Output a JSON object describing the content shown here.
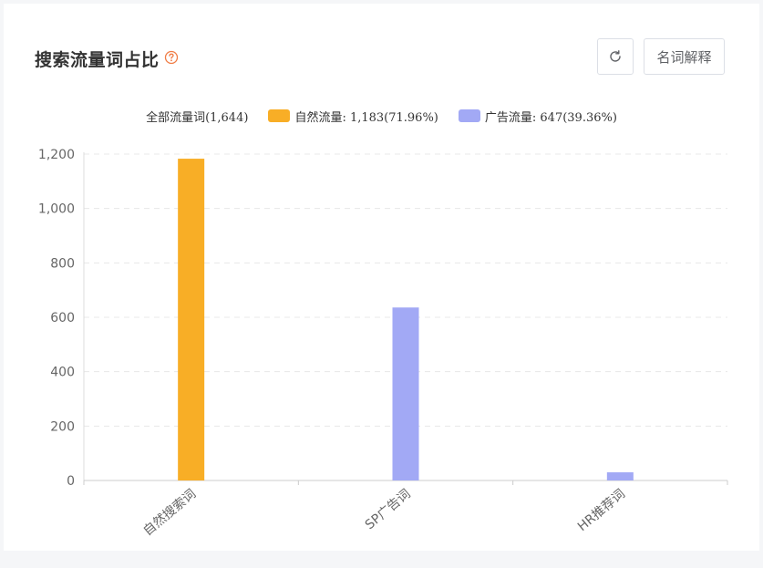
{
  "header": {
    "title": "搜索流量词占比",
    "glossary_label": "名词解释"
  },
  "icons": {
    "help": "question-circle-icon",
    "refresh": "refresh-icon"
  },
  "colors": {
    "natural": "#f8ae26",
    "ads": "#a2a9f5",
    "accent_help": "#f07c45"
  },
  "legend": {
    "total": "全部流量词(1,644)",
    "natural": "自然流量: 1,183(71.96%)",
    "ads": "广告流量: 647(39.36%)"
  },
  "chart_data": {
    "type": "bar",
    "categories": [
      "自然搜索词",
      "SP广告词",
      "HR推荐词"
    ],
    "series": [
      {
        "name": "自然流量",
        "values": [
          1183,
          0,
          0
        ]
      },
      {
        "name": "广告流量",
        "values": [
          0,
          636,
          30
        ]
      }
    ],
    "ylim": [
      0,
      1200
    ],
    "yticks": [
      0,
      200,
      400,
      600,
      800,
      1000,
      1200
    ],
    "ytick_labels": [
      "0",
      "200",
      "400",
      "600",
      "800",
      "1,000",
      "1,200"
    ],
    "grid": true,
    "legend_position": "top-center",
    "title": "",
    "xlabel": "",
    "ylabel": ""
  }
}
